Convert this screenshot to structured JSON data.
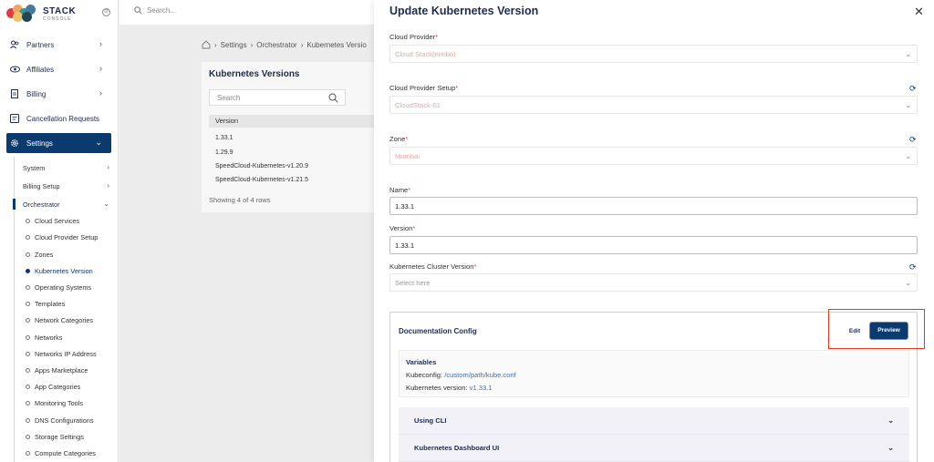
{
  "app": {
    "logo_text": "STACK",
    "logo_sub": "CONSOLE",
    "search_placeholder": "Search..."
  },
  "sidebar": {
    "items": [
      {
        "label": "Partners",
        "icon": "users-icon"
      },
      {
        "label": "Affiliates",
        "icon": "eye-icon"
      },
      {
        "label": "Billing",
        "icon": "document-icon"
      },
      {
        "label": "Cancellation Requests",
        "icon": "request-icon"
      },
      {
        "label": "Settings",
        "icon": "gear-icon"
      }
    ],
    "settings_sub": [
      {
        "label": "System"
      },
      {
        "label": "Billing Setup"
      },
      {
        "label": "Orchestrator"
      }
    ],
    "orchestrator_items": [
      "Cloud Services",
      "Cloud Provider Setup",
      "Zones",
      "Kubernetes Version",
      "Operating Systems",
      "Templates",
      "Network Categories",
      "Networks",
      "Networks IP Address",
      "Apps Marketplace",
      "App Categories",
      "Monitoring Tools",
      "DNS Configurations",
      "Storage Settings",
      "Compute Categories"
    ]
  },
  "breadcrumb": [
    "Settings",
    "Orchestrator",
    "Kubernetes Versio"
  ],
  "list": {
    "title": "Kubernetes Versions",
    "search_placeholder": "Search",
    "column": "Version",
    "rows": [
      "1.33.1",
      "1.29.9",
      "SpeedCloud-Kubernetes-v1.20.9",
      "SpeedCloud-Kubernetes-v1.21.5"
    ],
    "footer": "Showing 4 of 4 rows"
  },
  "drawer": {
    "title": "Update Kubernetes Version",
    "cloud_provider": {
      "label": "Cloud Provider",
      "value": "Cloud Stack(nimbo)"
    },
    "cloud_provider_setup": {
      "label": "Cloud Provider Setup",
      "value": "CloudStack-01"
    },
    "zone": {
      "label": "Zone",
      "value": "Mumbai"
    },
    "name": {
      "label": "Name",
      "value": "1.33.1"
    },
    "version": {
      "label": "Version",
      "value": "1.33.1"
    },
    "cluster_version": {
      "label": "Kubernetes Cluster Version",
      "placeholder": "Select here"
    },
    "required_mark": "*",
    "doc": {
      "title": "Documentation Config",
      "edit_label": "Edit",
      "preview_label": "Preview",
      "variables_title": "Variables",
      "kubeconfig_label": "Kubeconfig:",
      "kubeconfig_value": "/custom/path/kube.conf",
      "k8s_version_label": "Kubernetes version:",
      "k8s_version_value": "v1.33.1",
      "sections": [
        "Using CLI",
        "Kubernetes Dashboard UI"
      ]
    }
  },
  "colors": {
    "brand": "#0b3a6f",
    "required": "#e04545",
    "highlight_frame": "#e5391f"
  }
}
